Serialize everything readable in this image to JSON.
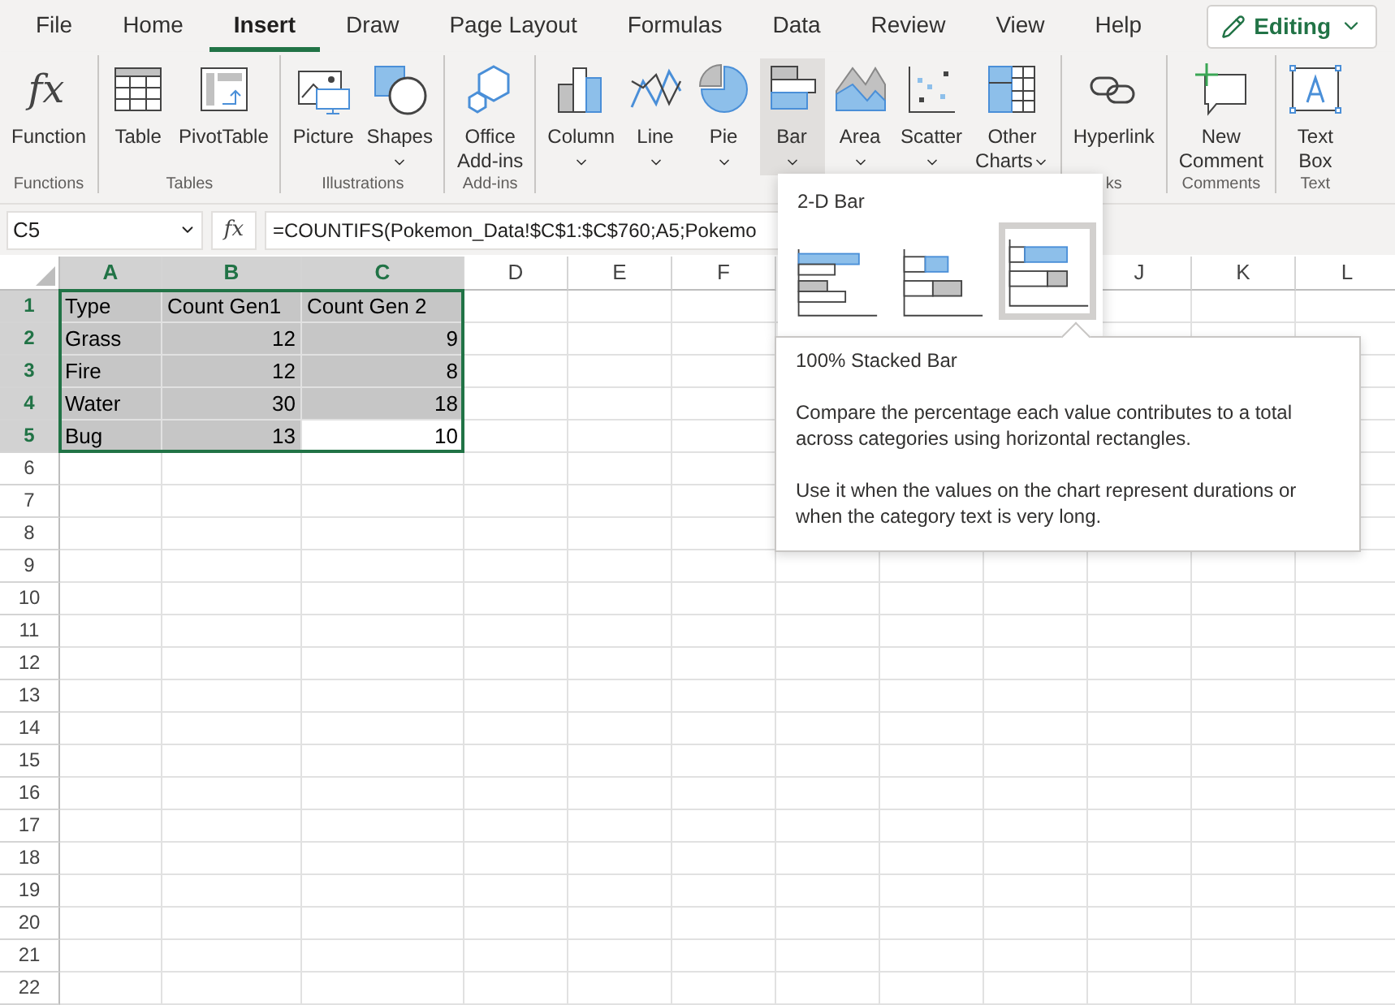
{
  "tabs": [
    {
      "label": "File",
      "selected": false
    },
    {
      "label": "Home",
      "selected": false
    },
    {
      "label": "Insert",
      "selected": true
    },
    {
      "label": "Draw",
      "selected": false
    },
    {
      "label": "Page Layout",
      "selected": false
    },
    {
      "label": "Formulas",
      "selected": false
    },
    {
      "label": "Data",
      "selected": false
    },
    {
      "label": "Review",
      "selected": false
    },
    {
      "label": "View",
      "selected": false
    },
    {
      "label": "Help",
      "selected": false
    }
  ],
  "editing_button": {
    "label": "Editing"
  },
  "ribbon_groups": [
    {
      "label": "Functions",
      "items": [
        {
          "kind": "function",
          "glyph": "fx",
          "lines": [
            "Function"
          ],
          "dropdown": false,
          "selected": false
        }
      ]
    },
    {
      "label": "Tables",
      "items": [
        {
          "kind": "table",
          "lines": [
            "Table"
          ],
          "dropdown": false,
          "selected": false
        },
        {
          "kind": "pivot",
          "lines": [
            "PivotTable"
          ],
          "dropdown": false,
          "selected": false
        }
      ]
    },
    {
      "label": "Illustrations",
      "items": [
        {
          "kind": "picture",
          "lines": [
            "Picture"
          ],
          "dropdown": false,
          "selected": false
        },
        {
          "kind": "shapes",
          "lines": [
            "Shapes"
          ],
          "dropdown": true,
          "selected": false
        }
      ]
    },
    {
      "label": "Add-ins",
      "items": [
        {
          "kind": "addins",
          "lines": [
            "Office",
            "Add-ins"
          ],
          "dropdown": false,
          "selected": false
        }
      ]
    },
    {
      "items": [
        {
          "kind": "column",
          "lines": [
            "Column"
          ],
          "dropdown": true,
          "selected": false
        },
        {
          "kind": "line",
          "lines": [
            "Line"
          ],
          "dropdown": true,
          "selected": false
        },
        {
          "kind": "pie",
          "lines": [
            "Pie"
          ],
          "dropdown": true,
          "selected": false
        },
        {
          "kind": "bar",
          "lines": [
            "Bar"
          ],
          "dropdown": true,
          "selected": true
        },
        {
          "kind": "area",
          "lines": [
            "Area"
          ],
          "dropdown": true,
          "selected": false
        },
        {
          "kind": "scatter",
          "lines": [
            "Scatter"
          ],
          "dropdown": true,
          "selected": false
        },
        {
          "kind": "other",
          "lines": [
            "Other",
            "Charts"
          ],
          "dropdown": true,
          "selected": false
        }
      ]
    },
    {
      "label": "ks",
      "items": [
        {
          "kind": "hyperlink",
          "lines": [
            "Hyperlink"
          ],
          "dropdown": false,
          "selected": false
        }
      ]
    },
    {
      "label": "Comments",
      "items": [
        {
          "kind": "comment",
          "lines": [
            "New",
            "Comment"
          ],
          "dropdown": false,
          "selected": false
        }
      ]
    },
    {
      "label": "Text",
      "items": [
        {
          "kind": "textbox",
          "lines": [
            "Text",
            "Box"
          ],
          "dropdown": false,
          "selected": false
        }
      ]
    }
  ],
  "formula_bar": {
    "name_box": "C5",
    "fx": "fx",
    "formula": "=COUNTIFS(Pokemon_Data!$C$1:$C$760;A5;Pokemo"
  },
  "columns": [
    {
      "label": "A",
      "selected": true
    },
    {
      "label": "B",
      "selected": true
    },
    {
      "label": "C",
      "selected": true
    },
    {
      "label": "D",
      "selected": false
    },
    {
      "label": "E",
      "selected": false
    },
    {
      "label": "F",
      "selected": false
    },
    {
      "label": "J",
      "selected": false
    },
    {
      "label": "K",
      "selected": false
    },
    {
      "label": "L",
      "selected": false
    }
  ],
  "rows": [
    {
      "number": "1",
      "selected": true,
      "cells": [
        {
          "text": "Type",
          "selected": true
        },
        {
          "text": "Count Gen1",
          "selected": true
        },
        {
          "text": "Count Gen 2",
          "selected": true
        }
      ]
    },
    {
      "number": "2",
      "selected": true,
      "cells": [
        {
          "text": "Grass",
          "selected": true
        },
        {
          "text": "12",
          "selected": true
        },
        {
          "text": "9",
          "selected": true
        }
      ]
    },
    {
      "number": "3",
      "selected": true,
      "cells": [
        {
          "text": "Fire",
          "selected": true
        },
        {
          "text": "12",
          "selected": true
        },
        {
          "text": "8",
          "selected": true
        }
      ]
    },
    {
      "number": "4",
      "selected": true,
      "cells": [
        {
          "text": "Water",
          "selected": true
        },
        {
          "text": "30",
          "selected": true
        },
        {
          "text": "18",
          "selected": true
        }
      ]
    },
    {
      "number": "5",
      "selected": true,
      "cells": [
        {
          "text": "Bug",
          "selected": true
        },
        {
          "text": "13",
          "selected": true
        },
        {
          "text": "10",
          "selected": false
        }
      ]
    },
    {
      "number": "6",
      "selected": false
    },
    {
      "number": "7",
      "selected": false
    },
    {
      "number": "8",
      "selected": false
    },
    {
      "number": "9",
      "selected": false
    },
    {
      "number": "10",
      "selected": false
    },
    {
      "number": "11",
      "selected": false
    },
    {
      "number": "12",
      "selected": false
    },
    {
      "number": "13",
      "selected": false
    },
    {
      "number": "14",
      "selected": false
    },
    {
      "number": "15",
      "selected": false
    },
    {
      "number": "16",
      "selected": false
    },
    {
      "number": "17",
      "selected": false
    },
    {
      "number": "18",
      "selected": false
    },
    {
      "number": "19",
      "selected": false
    },
    {
      "number": "20",
      "selected": false
    },
    {
      "number": "21",
      "selected": false
    },
    {
      "number": "22",
      "selected": false
    }
  ],
  "bar_menu": {
    "heading": "2-D Bar",
    "options": [
      {
        "kind": "clustered",
        "selected": false
      },
      {
        "kind": "stacked",
        "selected": false
      },
      {
        "kind": "stacked100",
        "selected": true
      }
    ]
  },
  "tooltip": {
    "title": "100% Stacked Bar",
    "paragraphs": [
      "Compare the percentage each value contributes to a total across categories using horizontal rectangles.",
      "Use it when the values on the chart represent durations or when the category text is very long."
    ]
  }
}
